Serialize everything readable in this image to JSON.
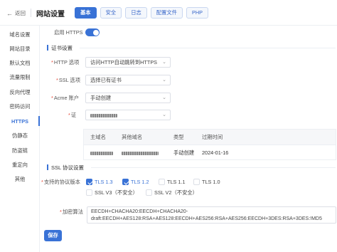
{
  "header": {
    "back_label": "返回",
    "title": "网站设置",
    "tabs": [
      {
        "label": "基本",
        "active": true
      },
      {
        "label": "安全",
        "active": false
      },
      {
        "label": "日志",
        "active": false
      },
      {
        "label": "配置文件",
        "active": false
      },
      {
        "label": "PHP",
        "active": false
      }
    ]
  },
  "sidebar": {
    "items": [
      {
        "label": "域名设置",
        "active": false
      },
      {
        "label": "网站目录",
        "active": false
      },
      {
        "label": "默认文档",
        "active": false
      },
      {
        "label": "流量限制",
        "active": false
      },
      {
        "label": "反向代理",
        "active": false
      },
      {
        "label": "密码访问",
        "active": false
      },
      {
        "label": "HTTPS",
        "active": true
      },
      {
        "label": "伪静态",
        "active": false
      },
      {
        "label": "防盗链",
        "active": false
      },
      {
        "label": "重定向",
        "active": false
      },
      {
        "label": "其他",
        "active": false
      }
    ]
  },
  "https": {
    "enable_label": "启用 HTTPS",
    "enabled": true,
    "cert_section_title": "证书设置",
    "http_option_label": "HTTP 选项",
    "http_option_value": "访问HTTP自动跳转到HTTPS",
    "ssl_option_label": "SSL 选项",
    "ssl_option_value": "选择已有证书",
    "acme_label": "Acme 账户",
    "acme_value": "手动创建",
    "cert_label": "证",
    "table": {
      "headers": [
        "主域名",
        "其他域名",
        "类型",
        "过期时间"
      ],
      "rows": [
        {
          "type": "手动创建",
          "expiry": "2024-01-16"
        }
      ]
    },
    "ssl_section_title": "SSL 协议设置",
    "protocols_label": "支持的协议版本",
    "protocols": [
      {
        "label": "TLS 1.3",
        "checked": true
      },
      {
        "label": "TLS 1.2",
        "checked": true
      },
      {
        "label": "TLS 1.1",
        "checked": false
      },
      {
        "label": "TLS 1.0",
        "checked": false
      },
      {
        "label": "SSL V3（不安全）",
        "checked": false
      },
      {
        "label": "SSL V2（不安全）",
        "checked": false
      }
    ],
    "cipher_label": "加密算法",
    "cipher_line1": "EECDH+CHACHA20:EECDH+CHACHA20-",
    "cipher_line2": "draft:EECDH+AES128:RSA+AES128:EECDH+AES256:RSA+AES256:EECDH+3DES:RSA+3DES:!MD5",
    "save_label": "保存",
    "accent_color": "#3972d6"
  }
}
